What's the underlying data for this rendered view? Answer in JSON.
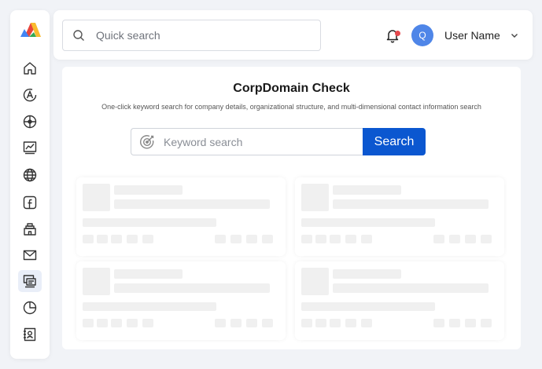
{
  "colors": {
    "accent": "#0b57d0",
    "avatar_bg": "#4f86e8",
    "notification_dot": "#e5484d",
    "skeleton": "#f0f0f0",
    "logo_red": "#e8453c",
    "logo_yellow": "#f9bb2d",
    "logo_blue": "#4285f4",
    "logo_green": "#34a853"
  },
  "sidebar": {
    "items": [
      {
        "icon": "home-icon",
        "name": "sidebar-item-home"
      },
      {
        "icon": "letter-a-circle-icon",
        "name": "sidebar-item-a"
      },
      {
        "icon": "hub-network-icon",
        "name": "sidebar-item-network"
      },
      {
        "icon": "line-chart-icon",
        "name": "sidebar-item-analytics"
      },
      {
        "icon": "globe-icon",
        "name": "sidebar-item-globe"
      },
      {
        "icon": "facebook-icon",
        "name": "sidebar-item-facebook"
      },
      {
        "icon": "building-icon",
        "name": "sidebar-item-building"
      },
      {
        "icon": "mail-icon",
        "name": "sidebar-item-mail"
      },
      {
        "icon": "corp-domain-icon",
        "name": "sidebar-item-corpdomain"
      },
      {
        "icon": "pie-chart-icon",
        "name": "sidebar-item-pie"
      },
      {
        "icon": "contact-card-icon",
        "name": "sidebar-item-contact"
      }
    ],
    "active_index": 8
  },
  "header": {
    "quick_search_placeholder": "Quick search",
    "avatar_initial": "Q",
    "user_name": "User Name"
  },
  "main": {
    "title": "CorpDomain Check",
    "subtitle": "One-click keyword search for company details, organizational structure, and multi-dimensional contact information search",
    "keyword_placeholder": "Keyword search",
    "search_button": "Search"
  }
}
